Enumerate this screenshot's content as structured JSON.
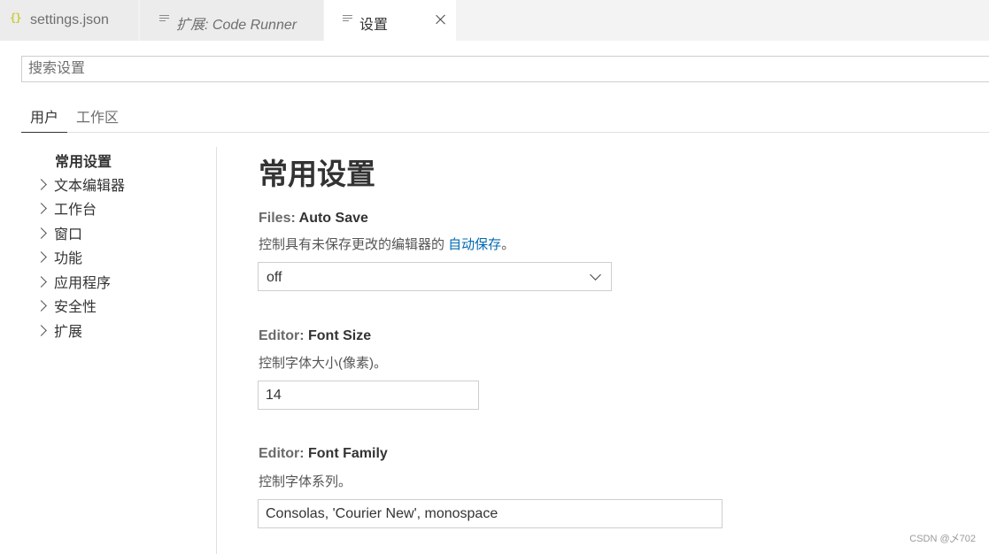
{
  "tabs": [
    {
      "label": "settings.json",
      "icon": "json-braces-icon"
    },
    {
      "label": "扩展: Code Runner",
      "icon": "preview-lines-icon"
    },
    {
      "label": "设置",
      "icon": "preview-lines-icon",
      "active": true
    }
  ],
  "search": {
    "placeholder": "搜索设置",
    "value": ""
  },
  "scope_tabs": {
    "user": "用户",
    "workspace": "工作区"
  },
  "toc": [
    {
      "label": "常用设置",
      "expandable": false
    },
    {
      "label": "文本编辑器",
      "expandable": true
    },
    {
      "label": "工作台",
      "expandable": true
    },
    {
      "label": "窗口",
      "expandable": true
    },
    {
      "label": "功能",
      "expandable": true
    },
    {
      "label": "应用程序",
      "expandable": true
    },
    {
      "label": "安全性",
      "expandable": true
    },
    {
      "label": "扩展",
      "expandable": true
    }
  ],
  "main": {
    "title": "常用设置",
    "settings": {
      "auto_save": {
        "category": "Files: ",
        "key": "Auto Save",
        "desc_prefix": "控制具有未保存更改的编辑器的 ",
        "desc_link": "自动保存",
        "desc_suffix": "。",
        "value": "off"
      },
      "font_size": {
        "category": "Editor: ",
        "key": "Font Size",
        "desc": "控制字体大小(像素)。",
        "value": "14"
      },
      "font_family": {
        "category": "Editor: ",
        "key": "Font Family",
        "desc": "控制字体系列。",
        "value": "Consolas, 'Courier New', monospace"
      }
    }
  },
  "watermark": "CSDN @乄702",
  "colors": {
    "link": "#006ab1",
    "json_icon": "#cbcb41",
    "tabbar_bg": "#f3f3f3"
  }
}
